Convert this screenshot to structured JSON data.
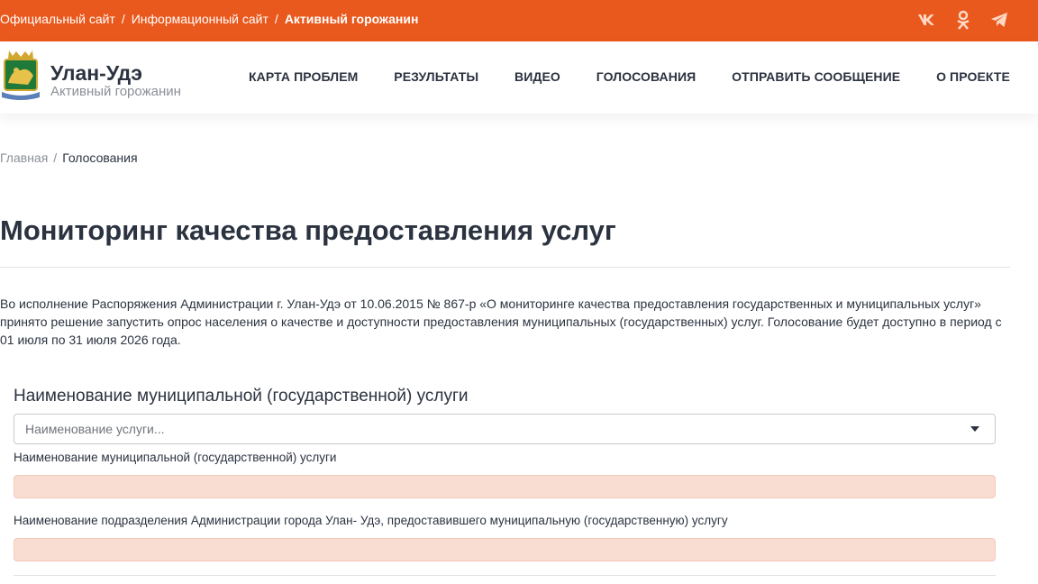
{
  "top_bar": {
    "crumbs": [
      "Официальный сайт",
      "Информационный сайт",
      "Активный горожанин"
    ],
    "separator": "/",
    "social_icons": [
      "vk-icon",
      "odnoklassniki-icon",
      "telegram-icon"
    ],
    "color": "#e9581c"
  },
  "header": {
    "brand_title": "Улан-Удэ",
    "brand_subtitle": "Активный горожанин",
    "nav": [
      "КАРТА ПРОБЛЕМ",
      "РЕЗУЛЬТАТЫ",
      "ВИДЕО",
      "ГОЛОСОВАНИЯ",
      "ОТПРАВИТЬ СООБЩЕНИЕ",
      "О ПРОЕКТЕ"
    ]
  },
  "breadcrumb": {
    "home": "Главная",
    "separator": "/",
    "current": "Голосования"
  },
  "page": {
    "title": "Мониторинг качества предоставления услуг",
    "intro": "Во исполнение Распоряжения Администрации г. Улан-Удэ от 10.06.2015 № 867-р «О мониторинге качества предоставления государственных и муниципальных услуг» принято решение запустить опрос населения о качестве и доступности предоставления муниципальных (государственных) услуг. Голосование будет доступно в период с 01 июля по 31 июля 2026 года."
  },
  "form": {
    "section_title": "Наименование муниципальной (государственной) услуги",
    "service_select_placeholder": "Наименование услуги...",
    "field1_label": "Наименование муниципальной (государственной) услуги",
    "field1_value": "",
    "field2_label": "Наименование подразделения Администрации города Улан- Удэ, предоставившего муниципальную (государственную) услугу",
    "field2_value": ""
  }
}
